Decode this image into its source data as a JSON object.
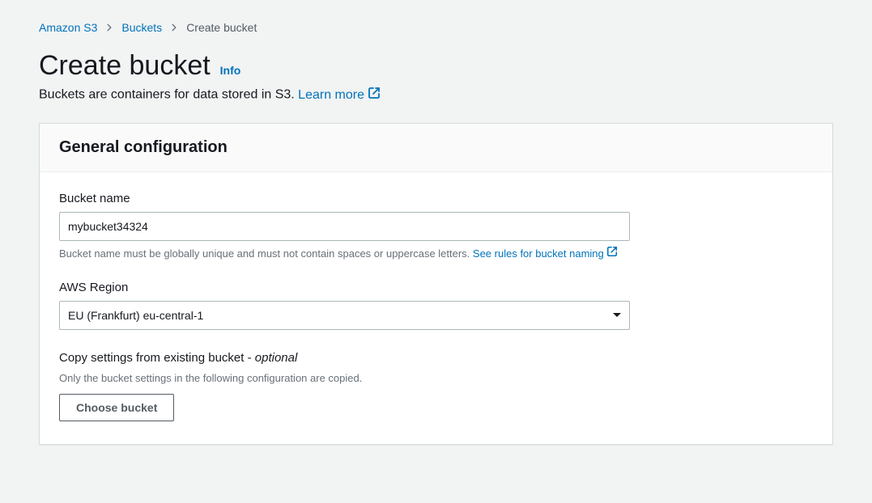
{
  "breadcrumbs": {
    "service": "Amazon S3",
    "buckets": "Buckets",
    "create": "Create bucket"
  },
  "page": {
    "title": "Create bucket",
    "info": "Info",
    "subtitle": "Buckets are containers for data stored in S3. ",
    "learn_more": "Learn more"
  },
  "panel": {
    "header": "General configuration"
  },
  "fields": {
    "bucket_name": {
      "label": "Bucket name",
      "value": "mybucket34324",
      "hint_text": "Bucket name must be globally unique and must not contain spaces or uppercase letters. ",
      "hint_link": "See rules for bucket naming"
    },
    "region": {
      "label": "AWS Region",
      "value": "EU (Frankfurt) eu-central-1"
    },
    "copy": {
      "label_main": "Copy settings from existing bucket - ",
      "label_optional": "optional",
      "description": "Only the bucket settings in the following configuration are copied.",
      "button": "Choose bucket"
    }
  }
}
